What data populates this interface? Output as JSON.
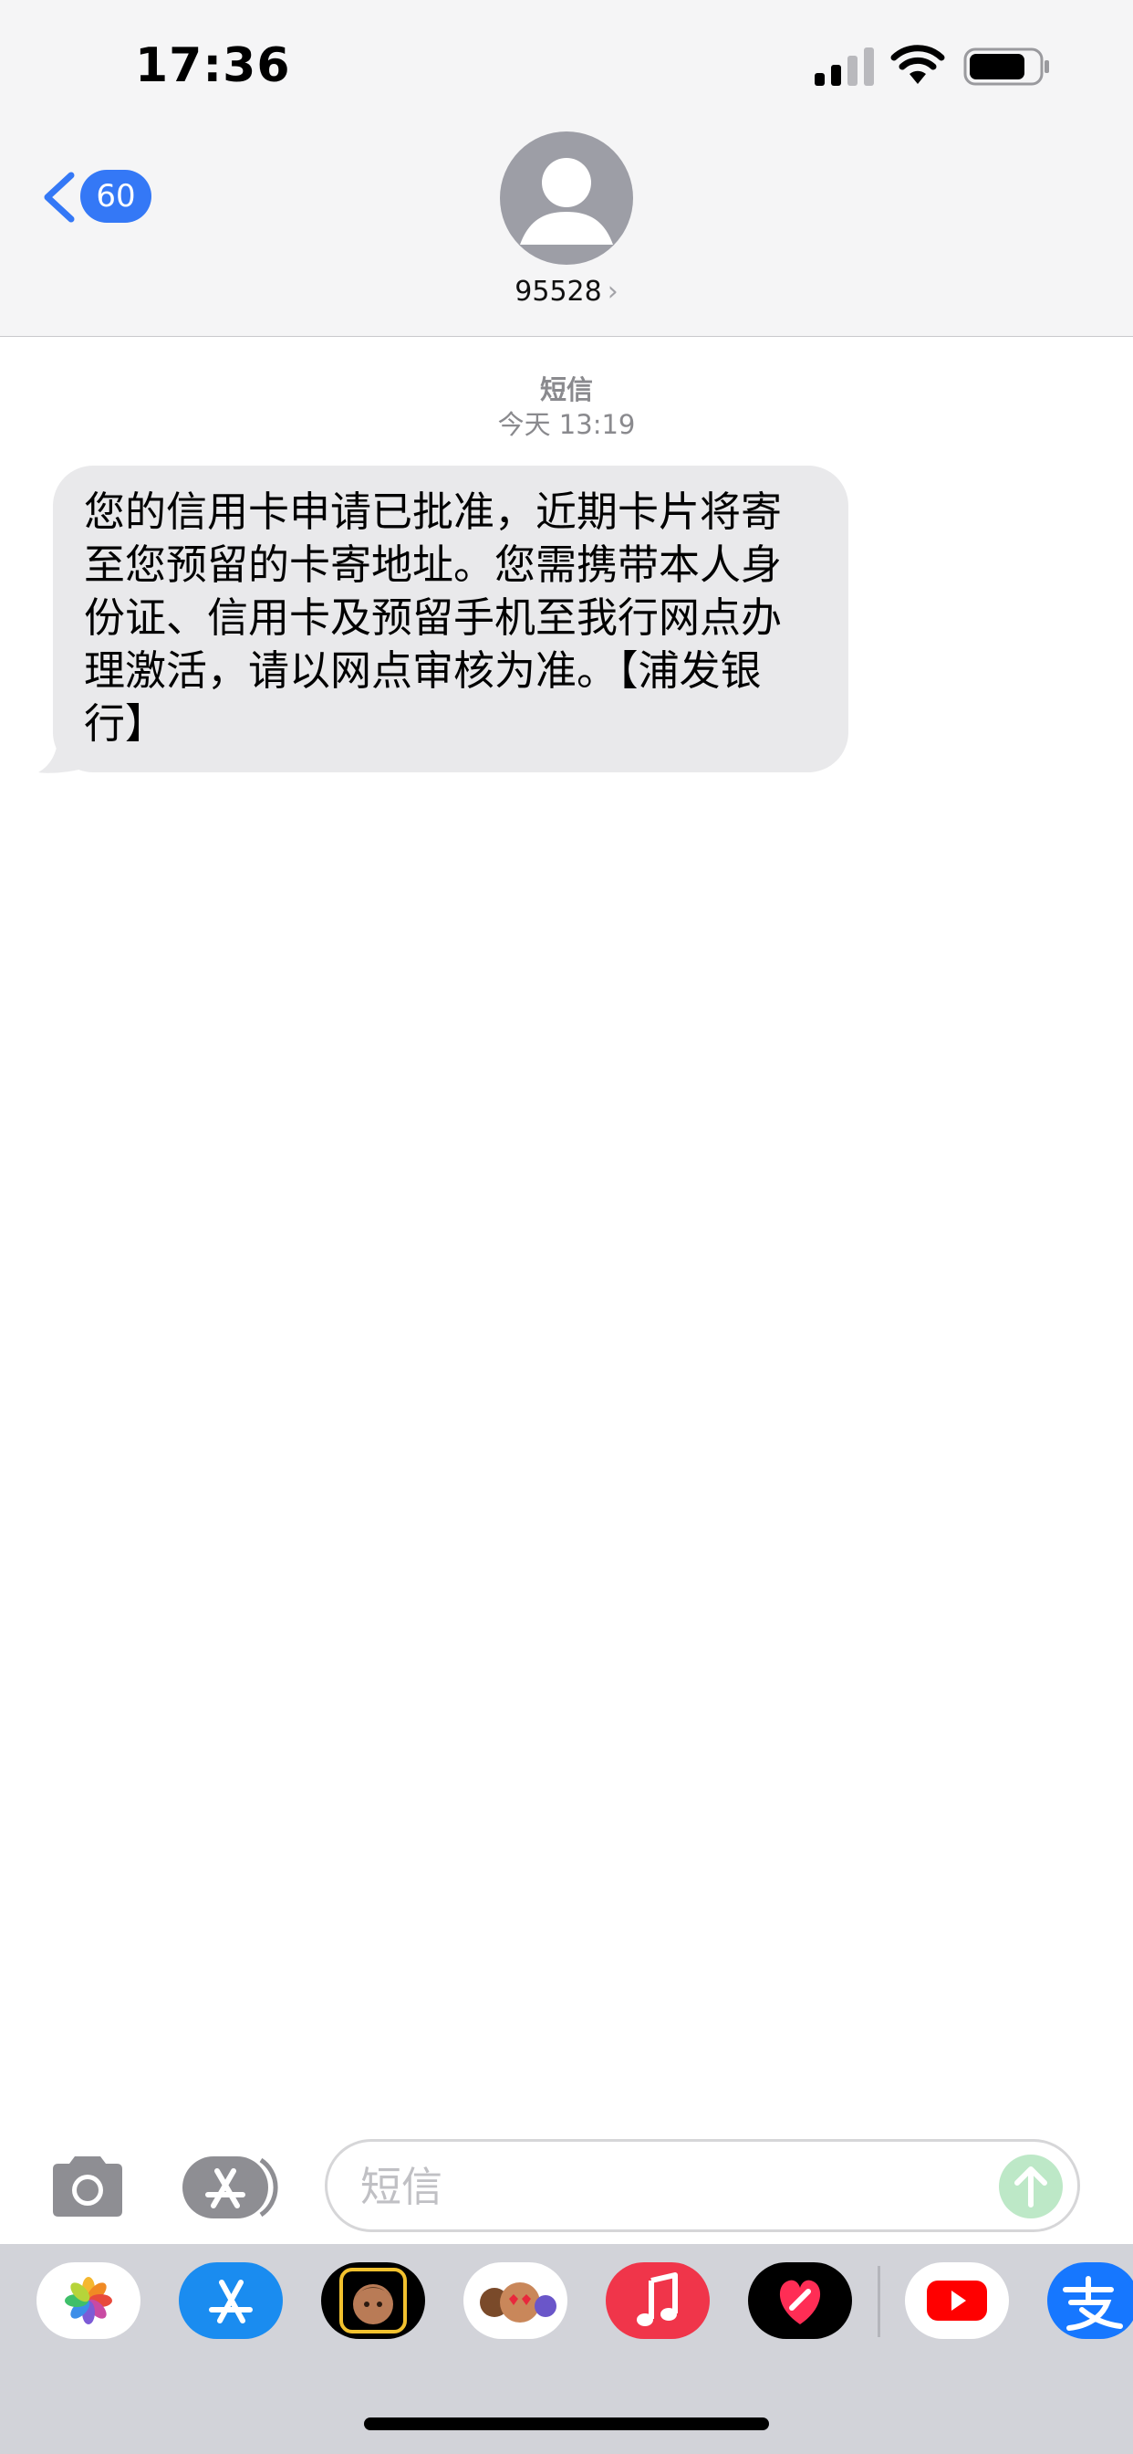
{
  "status_bar": {
    "time": "17:36"
  },
  "nav": {
    "back_count": "60",
    "contact_name": "95528",
    "contact_chevron": "›"
  },
  "conversation": {
    "service_label": "短信",
    "timestamp": "今天 13:19",
    "messages": [
      {
        "direction": "incoming",
        "text": "您的信用卡申请已批准，近期卡片将寄至您预留的卡寄地址。您需携带本人身份证、信用卡及预留手机至我行网点办理激活，请以网点审核为准。【浦发银行】"
      }
    ]
  },
  "input_bar": {
    "placeholder": "短信"
  },
  "app_drawer": {
    "apps": [
      {
        "icon": "photos-icon"
      },
      {
        "icon": "app-store-icon"
      },
      {
        "icon": "memoji-icon"
      },
      {
        "icon": "animoji-stickers-icon"
      },
      {
        "icon": "music-icon"
      },
      {
        "icon": "digital-touch-icon"
      },
      {
        "icon": "youtube-icon"
      },
      {
        "icon": "alipay-icon"
      }
    ]
  },
  "colors": {
    "accent": "#3478f6",
    "incoming_bubble": "#e9e9eb",
    "send_disabled": "#bde8c7"
  }
}
